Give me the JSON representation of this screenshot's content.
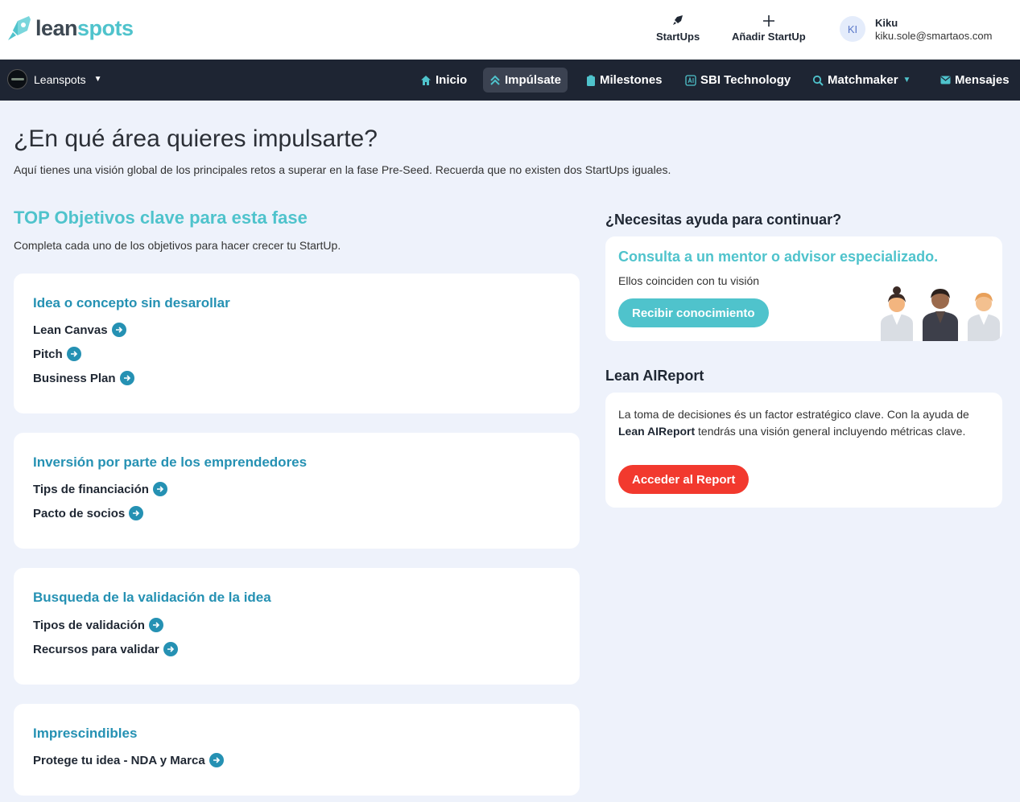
{
  "header": {
    "logo_lean": "lean",
    "logo_spots": "spots",
    "startups_label": "StartUps",
    "add_startup_label": "Añadir StartUp",
    "user": {
      "initials": "KI",
      "name": "Kiku",
      "email": "kiku.sole@smartaos.com"
    }
  },
  "nav": {
    "brand_name": "Leanspots",
    "items": [
      {
        "label": "Inicio",
        "icon": "home-icon"
      },
      {
        "label": "Impúlsate",
        "icon": "chevrons-up-icon",
        "active": true
      },
      {
        "label": "Milestones",
        "icon": "clipboard-icon"
      },
      {
        "label": "SBI Technology",
        "icon": "ai-chip-icon"
      },
      {
        "label": "Matchmaker",
        "icon": "search-icon",
        "dropdown": true
      },
      {
        "label": "Mensajes",
        "icon": "mail-icon"
      }
    ]
  },
  "main": {
    "title": "¿En qué área quieres impulsarte?",
    "subtitle": "Aquí tienes una visión global de los principales retos a superar en la fase Pre-Seed. Recuerda que no existen dos StartUps iguales.",
    "section_title": "TOP Objetivos clave para esta fase",
    "section_subtitle": "Completa cada uno de los objetivos para hacer crecer tu StartUp.",
    "cards": [
      {
        "title": "Idea o concepto sin desarollar",
        "links": [
          "Lean Canvas",
          "Pitch",
          "Business Plan"
        ]
      },
      {
        "title": "Inversión por parte de los emprendedores",
        "links": [
          "Tips de financiación",
          "Pacto de socios"
        ]
      },
      {
        "title": "Busqueda de la validación de la idea",
        "links": [
          "Tipos de validación",
          "Recursos para validar"
        ]
      },
      {
        "title": "Imprescindibles",
        "links": [
          "Protege tu idea - NDA y Marca"
        ]
      }
    ]
  },
  "help": {
    "title": "¿Necesitas ayuda para continuar?",
    "card_title": "Consulta a un mentor o advisor especializado.",
    "card_subtitle": "Ellos coinciden con tu visión",
    "button": "Recibir conocimiento"
  },
  "report": {
    "title": "Lean AIReport",
    "text_1": "La toma de decisiones és un factor estratégico clave. Con la ayuda de ",
    "text_bold": "Lean AIReport",
    "text_2": " tendrás una visión general incluyendo métricas clave.",
    "button": "Acceder al Report"
  },
  "colors": {
    "accent_teal": "#4fc3cc",
    "link_blue": "#2591b3",
    "nav_bg": "#1e2533",
    "report_red": "#f2392e",
    "page_bg": "#eef2fb"
  }
}
